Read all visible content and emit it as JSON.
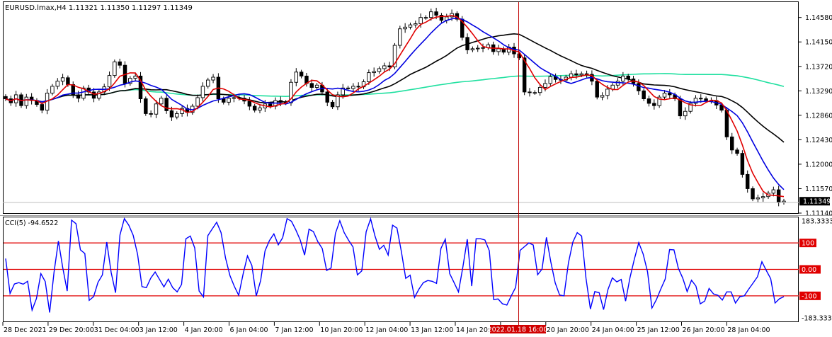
{
  "header": {
    "text": "EURUSD.lmax,H4  1.11321 1.11350 1.11297 1.11349"
  },
  "indicator": {
    "label": "CCI(5) -94.6522"
  },
  "colors": {
    "background": "#ffffff",
    "candle": "#000000",
    "grid": "#000000",
    "ma_fast": "#e00000",
    "ma_mid": "#0000e0",
    "ma_slow": "#000000",
    "ma_long": "#20e0a0",
    "cci": "#0000ff",
    "level_line": "#e00000",
    "crosshair": "#c00000",
    "price_tag_bg": "#000000",
    "price_tag_fg": "#ffffff",
    "crosshair_tag_bg": "#d00000"
  },
  "price_axis": {
    "labels": [
      "1.14580",
      "1.14150",
      "1.13720",
      "1.13290",
      "1.12860",
      "1.12430",
      "1.12000",
      "1.11570",
      "1.11140"
    ],
    "current_price": "1.11349"
  },
  "cci_axis": {
    "labels": [
      "183.3333",
      "100",
      "0.00",
      "-100",
      "-183.3333"
    ]
  },
  "time_axis": {
    "labels": [
      "28 Dec 2021",
      "29 Dec 20:00",
      "31 Dec 04:00",
      "3 Jan 12:00",
      "4 Jan 20:00",
      "6 Jan 04:00",
      "7 Jan 12:00",
      "10 Jan 20:00",
      "12 Jan 04:00",
      "13 Jan 12:00",
      "14 Jan 20:00",
      "19 Jan 12:00",
      "20 Jan 20:00",
      "24 Jan 04:00",
      "25 Jan 12:00",
      "26 Jan 20:00",
      "28 Jan 04:00"
    ],
    "crosshair_time": "2022.01.18 16:00"
  },
  "chart_data": [
    {
      "type": "candlestick",
      "symbol": "EURUSD.lmax",
      "timeframe": "H4",
      "ohlc_last": {
        "open": 1.11321,
        "high": 1.1135,
        "low": 1.11297,
        "close": 1.11349
      },
      "ylim": [
        1.1114,
        1.1485
      ],
      "close_series": [
        1.1315,
        1.1308,
        1.1322,
        1.1303,
        1.1318,
        1.1312,
        1.1305,
        1.1295,
        1.1325,
        1.1337,
        1.1346,
        1.1352,
        1.134,
        1.1322,
        1.1316,
        1.1334,
        1.1327,
        1.1316,
        1.1327,
        1.1336,
        1.1356,
        1.138,
        1.1374,
        1.1342,
        1.1351,
        1.1355,
        1.1315,
        1.1289,
        1.1288,
        1.1306,
        1.1316,
        1.1294,
        1.1283,
        1.1289,
        1.1298,
        1.1291,
        1.1302,
        1.1317,
        1.1337,
        1.1348,
        1.1353,
        1.1315,
        1.1309,
        1.1316,
        1.1317,
        1.1316,
        1.1311,
        1.1302,
        1.1295,
        1.1299,
        1.1306,
        1.1302,
        1.1312,
        1.1309,
        1.1308,
        1.1344,
        1.1362,
        1.1355,
        1.1342,
        1.1335,
        1.1339,
        1.1327,
        1.1309,
        1.1301,
        1.1322,
        1.1334,
        1.1333,
        1.1337,
        1.1336,
        1.1345,
        1.1361,
        1.1363,
        1.1368,
        1.1373,
        1.1371,
        1.1409,
        1.1438,
        1.1441,
        1.1445,
        1.1447,
        1.1458,
        1.1458,
        1.1468,
        1.1462,
        1.1453,
        1.1459,
        1.1465,
        1.1455,
        1.1423,
        1.1401,
        1.1403,
        1.1404,
        1.1405,
        1.141,
        1.1398,
        1.1403,
        1.1397,
        1.1406,
        1.1394,
        1.1387,
        1.1327,
        1.1326,
        1.1326,
        1.1335,
        1.1342,
        1.1354,
        1.1349,
        1.1348,
        1.1353,
        1.1359,
        1.1357,
        1.1359,
        1.1358,
        1.1346,
        1.1318,
        1.1321,
        1.1332,
        1.1339,
        1.1346,
        1.1355,
        1.135,
        1.1342,
        1.1329,
        1.1315,
        1.1307,
        1.1303,
        1.1318,
        1.1325,
        1.1322,
        1.1315,
        1.1285,
        1.1293,
        1.1307,
        1.1316,
        1.1315,
        1.1312,
        1.1312,
        1.1304,
        1.1295,
        1.1248,
        1.1225,
        1.1219,
        1.1182,
        1.1157,
        1.1139,
        1.1141,
        1.1143,
        1.1149,
        1.1155,
        1.1133,
        1.1135
      ]
    },
    {
      "type": "line",
      "name": "CCI(5)",
      "ylim": [
        -183.3333,
        183.3333
      ],
      "levels": [
        100,
        0,
        -100
      ],
      "values": [
        41,
        -91,
        -55,
        -50,
        -56,
        -45,
        -154,
        -110,
        -16,
        -46,
        -163,
        -11,
        107,
        5,
        -82,
        186,
        173,
        74,
        60,
        -117,
        -103,
        -49,
        -21,
        103,
        -12,
        -88,
        130,
        192,
        167,
        129,
        57,
        -65,
        -69,
        -33,
        -10,
        -38,
        -66,
        -37,
        -69,
        -85,
        -57,
        116,
        126,
        81,
        -82,
        -104,
        128,
        153,
        178,
        139,
        43,
        -23,
        -64,
        -98,
        -18,
        51,
        15,
        -100,
        -42,
        70,
        109,
        134,
        93,
        120,
        192,
        182,
        149,
        111,
        54,
        152,
        143,
        105,
        79,
        -4,
        5,
        136,
        184,
        139,
        110,
        85,
        -21,
        -6,
        142,
        191,
        126,
        76,
        91,
        54,
        167,
        156,
        68,
        -34,
        -22,
        -106,
        -75,
        -50,
        -42,
        -45,
        -53,
        79,
        114,
        -16,
        -50,
        -85,
        9,
        114,
        -63,
        116,
        116,
        111,
        71,
        -114,
        -112,
        -130,
        -135,
        -100,
        -68,
        72,
        86,
        100,
        92,
        -20,
        1,
        121,
        28,
        -51,
        -97,
        -100,
        25,
        103,
        139,
        126,
        -34,
        -150,
        -84,
        -88,
        -152,
        -76,
        -32,
        -47,
        -38,
        -120,
        -31,
        39,
        101,
        58,
        -9,
        -146,
        -115,
        -75,
        -37,
        75,
        74,
        4,
        -33,
        -84,
        -41,
        -63,
        -130,
        -120,
        -72,
        -93,
        -98,
        -116,
        -85,
        -85,
        -127,
        -103,
        -100,
        -75,
        -52,
        -28,
        29,
        -4,
        -35,
        -127,
        -111,
        -103
      ]
    }
  ]
}
